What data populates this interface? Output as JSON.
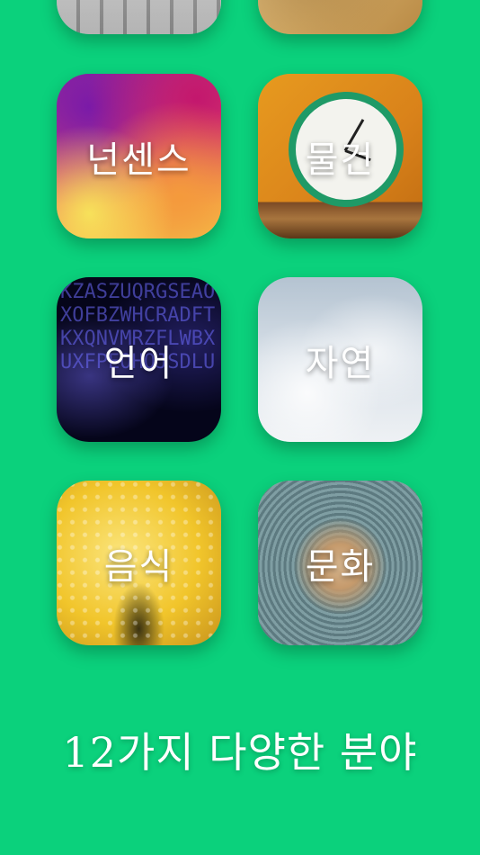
{
  "categories": [
    {
      "label": "넌센스",
      "image": "abstract-wave-image"
    },
    {
      "label": "물건",
      "image": "alarm-clock-image"
    },
    {
      "label": "언어",
      "image": "letters-image"
    },
    {
      "label": "자연",
      "image": "clouds-image"
    },
    {
      "label": "음식",
      "image": "lemon-image"
    },
    {
      "label": "문화",
      "image": "vinyl-record-image"
    }
  ],
  "partial_tiles": [
    {
      "image": "keyboard-image"
    },
    {
      "image": "map-image"
    }
  ],
  "letters_decoration": "KZASZUQRGSEAOXOFBZWHCRADFTKXQNVMRZFLWBXUXFPEOHQJSDLU",
  "footer": {
    "text": "12가지 다양한 분야"
  },
  "colors": {
    "background": "#0bd17c",
    "label_text": "#ffffff"
  }
}
